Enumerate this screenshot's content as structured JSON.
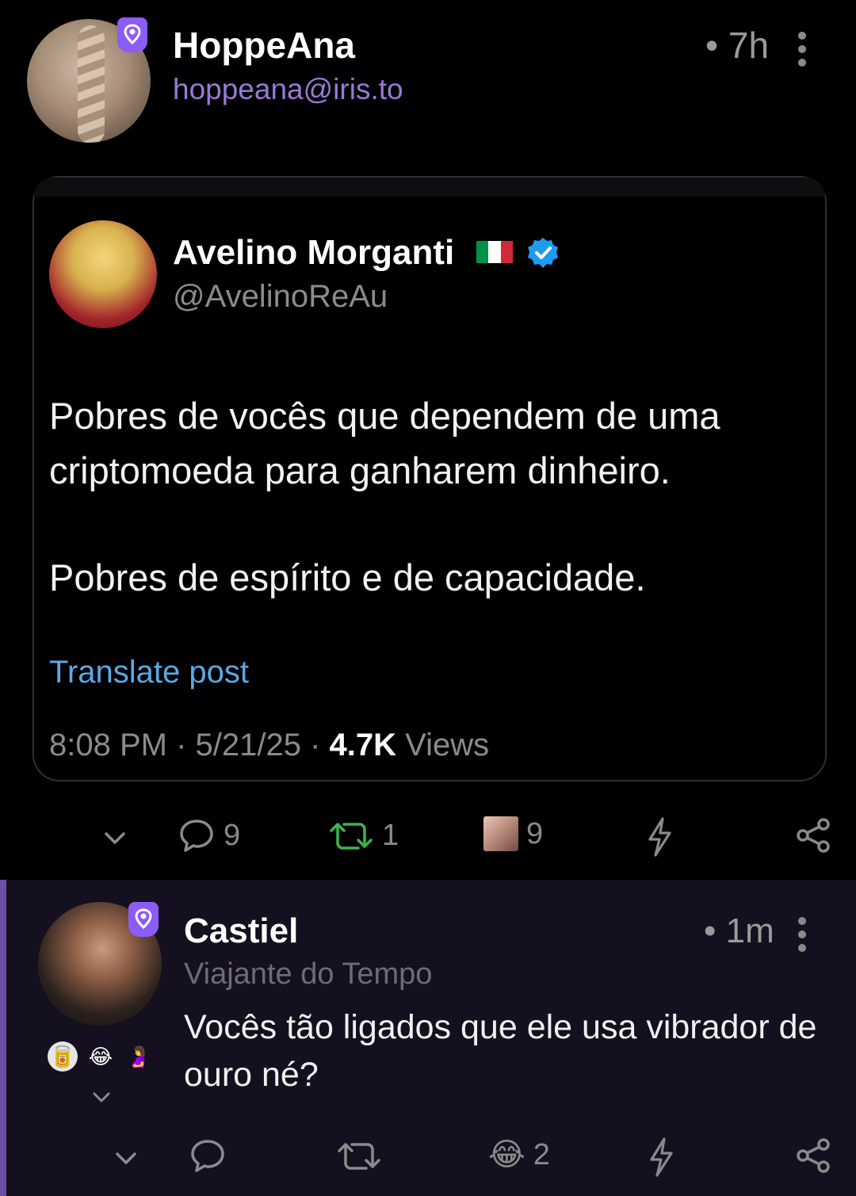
{
  "post": {
    "author_name": "HoppeAna",
    "author_handle": "hoppeana@iris.to",
    "time": "• 7h"
  },
  "embedded_tweet": {
    "name": "Avelino Morganti",
    "flag_colors": [
      "#009246",
      "#ffffff",
      "#ce2b37"
    ],
    "verified_color": "#1d9bf0",
    "handle": "@AvelinoReAu",
    "body": [
      "Pobres de vocês que dependem de uma criptomoeda para ganharem dinheiro.",
      "Pobres de espírito e de capacidade."
    ],
    "translate_label": "Translate post",
    "meta_prefix": "8:08 PM · 5/21/25 · ",
    "views_count": "4.7K",
    "views_label": " Views"
  },
  "post_actions": {
    "replies": "9",
    "reposts": "1",
    "reactions": "9",
    "icons": [
      "chevron-down-icon",
      "reply-icon",
      "repost-icon",
      "reaction-image",
      "zap-icon",
      "share-icon"
    ],
    "repost_color": "#3bb54a"
  },
  "reply": {
    "author_name": "Castiel",
    "subtitle": "Viajante do Tempo",
    "time": "• 1m",
    "body": "Vocês tão ligados que ele usa vibrador de ouro né?",
    "mini_reactions": [
      "🥫",
      "😂",
      "🤰"
    ]
  },
  "reply_actions": {
    "reaction_emoji": "😂",
    "reactions": "2"
  },
  "colors": {
    "accent": "#8b5cf6",
    "handle": "#9b79d6",
    "link": "#5aa9e6",
    "reply_bg": "#15101f"
  }
}
